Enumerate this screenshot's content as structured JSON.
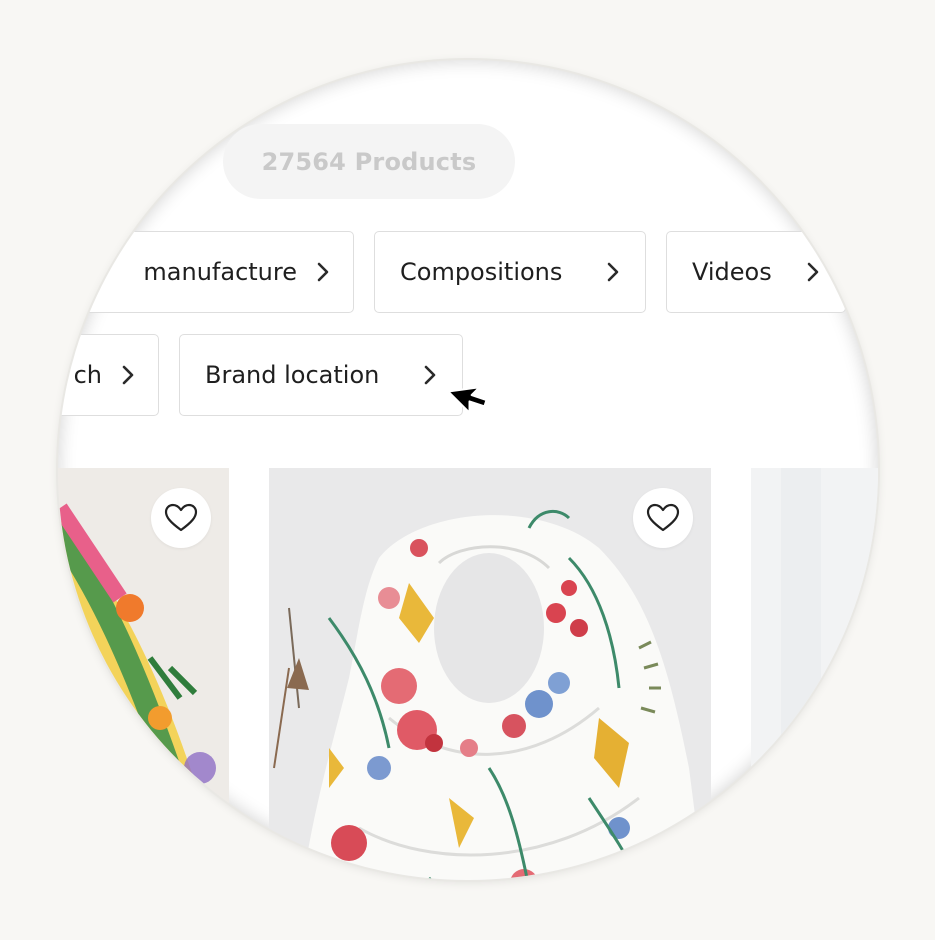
{
  "product_count": "27564 Products",
  "filters": {
    "manufacture": "manufacture",
    "compositions": "Compositions",
    "videos": "Videos",
    "search": "ch",
    "brand_location": "Brand location"
  },
  "colors": {
    "background": "#f8f7f4",
    "chip_border": "#dedede",
    "text": "#1f1f1f",
    "pill_text": "#c9c9c9"
  },
  "icons": {
    "chevron": "chevron-right-icon",
    "favorite": "heart-outline-icon",
    "cursor": "mouse-pointer-icon"
  }
}
